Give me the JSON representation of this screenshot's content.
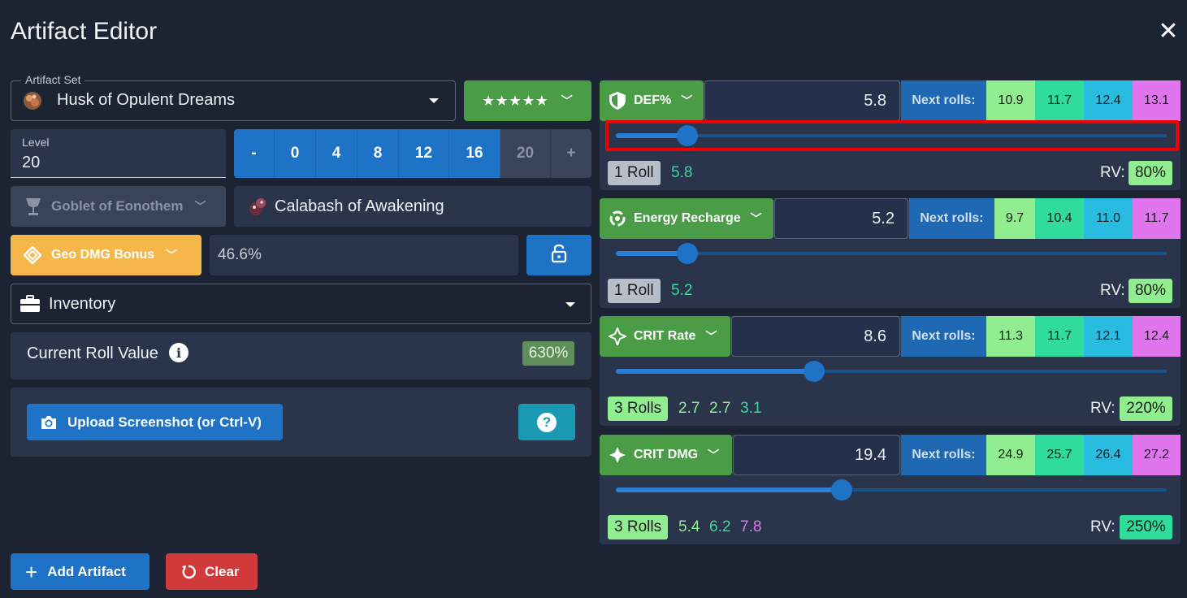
{
  "window": {
    "title": "Artifact Editor"
  },
  "artifact_set": {
    "legend": "Artifact Set",
    "name": "Husk of Opulent Dreams"
  },
  "rarity": {
    "stars": "★★★★★"
  },
  "level": {
    "label": "Level",
    "value": "20",
    "buttons": [
      "-",
      "0",
      "4",
      "8",
      "12",
      "16",
      "20",
      "+"
    ]
  },
  "slot": {
    "label": "Goblet of Eonothem"
  },
  "artifact_name": "Calabash of Awakening",
  "main_stat": {
    "label": "Geo DMG Bonus",
    "value": "46.6%"
  },
  "location": {
    "label": "Inventory"
  },
  "roll_value": {
    "label": "Current Roll Value",
    "value": "630%"
  },
  "upload": {
    "label": "Upload Screenshot (or Ctrl-V)"
  },
  "actions": {
    "add": "Add Artifact",
    "clear": "Clear"
  },
  "substats": [
    {
      "name": "DEF%",
      "value": "5.8",
      "next_label": "Next rolls:",
      "next": [
        "10.9",
        "11.7",
        "12.4",
        "13.1"
      ],
      "rolls_label": "1 Roll",
      "rolls": [
        "5.8"
      ],
      "rv_label": "RV:",
      "rv": "80%",
      "slider_fraction": 0.13
    },
    {
      "name": "Energy Recharge",
      "value": "5.2",
      "next_label": "Next rolls:",
      "next": [
        "9.7",
        "10.4",
        "11.0",
        "11.7"
      ],
      "rolls_label": "1 Roll",
      "rolls": [
        "5.2"
      ],
      "rv_label": "RV:",
      "rv": "80%",
      "slider_fraction": 0.13
    },
    {
      "name": "CRIT Rate",
      "value": "8.6",
      "next_label": "Next rolls:",
      "next": [
        "11.3",
        "11.7",
        "12.1",
        "12.4"
      ],
      "rolls_label": "3 Rolls",
      "rolls": [
        "2.7",
        "2.7",
        "3.1"
      ],
      "rv_label": "RV:",
      "rv": "220%",
      "slider_fraction": 0.36
    },
    {
      "name": "CRIT DMG",
      "value": "19.4",
      "next_label": "Next rolls:",
      "next": [
        "24.9",
        "25.7",
        "26.4",
        "27.2"
      ],
      "rolls_label": "3 Rolls",
      "rolls": [
        "5.4",
        "6.2",
        "7.8"
      ],
      "rv_label": "RV:",
      "rv": "250%",
      "slider_fraction": 0.41
    }
  ],
  "colors": {
    "green": "#4a9c46",
    "blue": "#1e73c6",
    "geo": "#f6b74a",
    "red": "#d03a3a",
    "highlight": "#f00000"
  }
}
